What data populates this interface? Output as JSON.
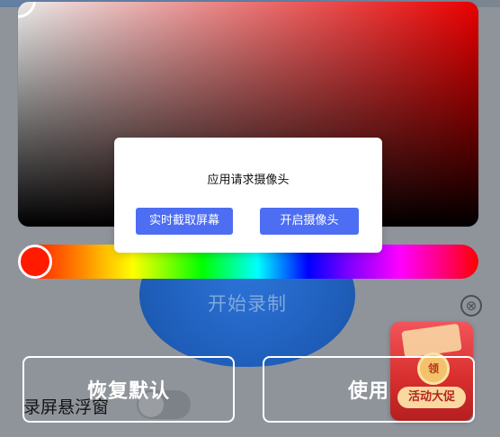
{
  "background_app": {
    "record_button_label": "开始录制",
    "close_icon_glyph": "⊗",
    "promo": {
      "label": "活动大促",
      "coin_text": "领"
    },
    "float_window_label": "录屏悬浮窗",
    "float_window_toggle_on": false,
    "reset_button_label": "恢复默认",
    "use_button_label": "使用"
  },
  "color_picker": {
    "selected_hue_color": "#ff1a00",
    "sv_base_color": "#ff0000"
  },
  "dialog": {
    "title": "应用请求摄像头",
    "screen_capture_button": "实时截取屏幕",
    "camera_button": "开启摄像头",
    "accent_color": "#4d6ef2"
  }
}
